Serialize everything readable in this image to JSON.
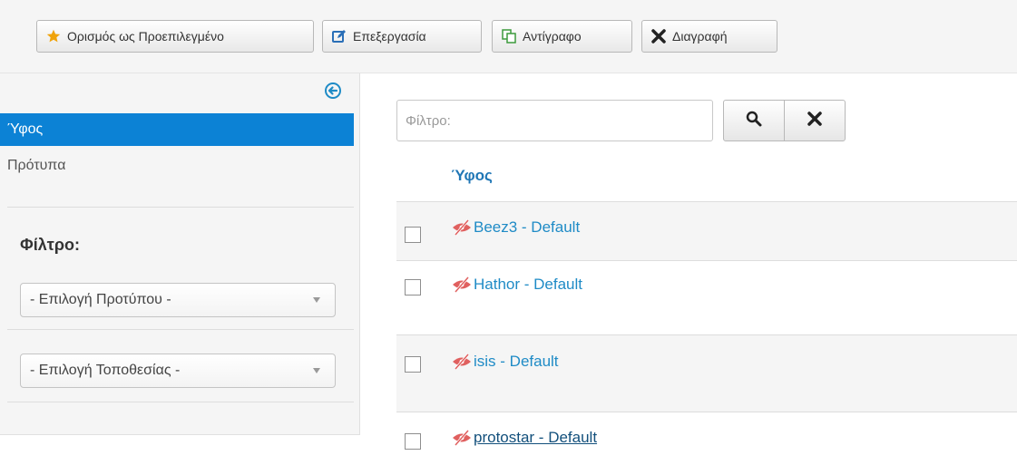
{
  "toolbar": {
    "buttons": [
      {
        "label": "Ορισμός ως Προεπιλεγμένο",
        "icon": "star-icon"
      },
      {
        "label": "Επεξεργασία",
        "icon": "edit-icon"
      },
      {
        "label": "Αντίγραφο",
        "icon": "copy-icon"
      },
      {
        "label": "Διαγραφή",
        "icon": "close-icon"
      }
    ]
  },
  "sidebar": {
    "collapse_icon": "arrow-left-circle-icon",
    "items": [
      {
        "label": "Ύφος",
        "active": true
      },
      {
        "label": "Πρότυπα",
        "active": false
      }
    ],
    "filter_heading": "Φίλτρο:",
    "selects": [
      {
        "value": "- Επιλογή Προτύπου -"
      },
      {
        "value": "- Επιλογή Τοποθεσίας -"
      }
    ]
  },
  "main": {
    "filter": {
      "placeholder": "Φίλτρο:",
      "value": ""
    },
    "search_icon": "search-icon",
    "clear_icon": "close-icon",
    "column_header": "Ύφος",
    "rows": [
      {
        "name": "Beez3 - Default",
        "icon": "eye-slash-icon"
      },
      {
        "name": "Hathor - Default",
        "icon": "eye-slash-icon"
      },
      {
        "name": "isis - Default",
        "icon": "eye-slash-icon"
      },
      {
        "name": "protostar - Default",
        "icon": "eye-slash-icon"
      }
    ]
  },
  "colors": {
    "accent": "#0c82d5",
    "link": "#1f8bc6",
    "star": "#f0a30a",
    "edit": "#2a6fb7",
    "copy": "#3c9a3c",
    "eye_slash": "#e0605f"
  }
}
